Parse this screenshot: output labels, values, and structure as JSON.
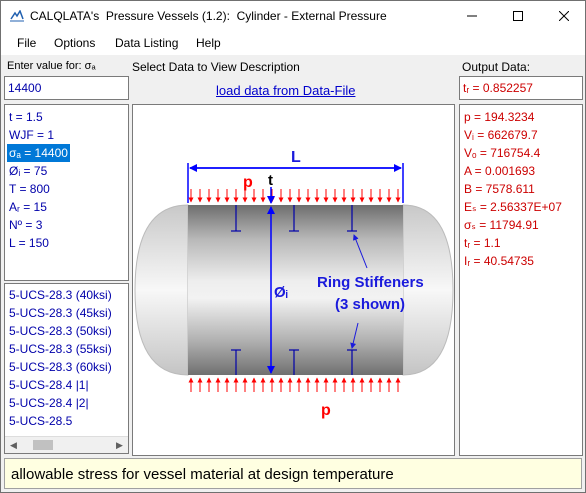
{
  "window": {
    "title": "CALQLATA's  Pressure Vessels (1.2):  Cylinder - External Pressure",
    "min_label": "—",
    "max_label": "☐",
    "close_label": "✕"
  },
  "menu": [
    "File",
    "Options",
    "Data Listing",
    "Help"
  ],
  "input_panel": {
    "label": "Enter value for: σₐ",
    "value": "14400"
  },
  "center_panel": {
    "label": "Select Data to View Description",
    "link": "load data from Data-File"
  },
  "output_panel": {
    "label": "Output Data:",
    "value": "tᵣ = 0.852257"
  },
  "inputs": [
    "t = 1.5",
    "WJF = 1",
    "σₐ = 14400",
    "Øᵢ = 75",
    "T = 800",
    "Aᵣ = 15",
    "Nº = 3",
    "L = 150"
  ],
  "selected_input_index": 2,
  "references": [
    "5-UCS-28.3 (40ksi)",
    "5-UCS-28.3 (45ksi)",
    "5-UCS-28.3 (50ksi)",
    "5-UCS-28.3 (55ksi)",
    "5-UCS-28.3 (60ksi)",
    "5-UCS-28.4 |1|",
    "5-UCS-28.4 |2|",
    "5-UCS-28.5"
  ],
  "outputs": [
    "p = 194.3234",
    "Vᵢ = 662679.7",
    "Vₒ = 716754.4",
    "A = 0.001693",
    "B = 7578.611",
    "Eₛ = 2.56337E+07",
    "σₛ = 11794.91",
    "tᵣ = 1.1",
    "Iᵣ = 40.54735"
  ],
  "diagram": {
    "label_L": "L",
    "label_p_top": "p",
    "label_t": "t",
    "label_p_bottom": "p",
    "label_diameter": "Øᵢ",
    "label_stiffeners_1": "Ring Stiffeners",
    "label_stiffeners_2": "(3 shown)",
    "colors": {
      "arrow_blue": "#0000ff",
      "arrow_red": "#ff0000",
      "text_blue": "#1a1adc"
    }
  },
  "status_text": "allowable stress for vessel material at design temperature"
}
